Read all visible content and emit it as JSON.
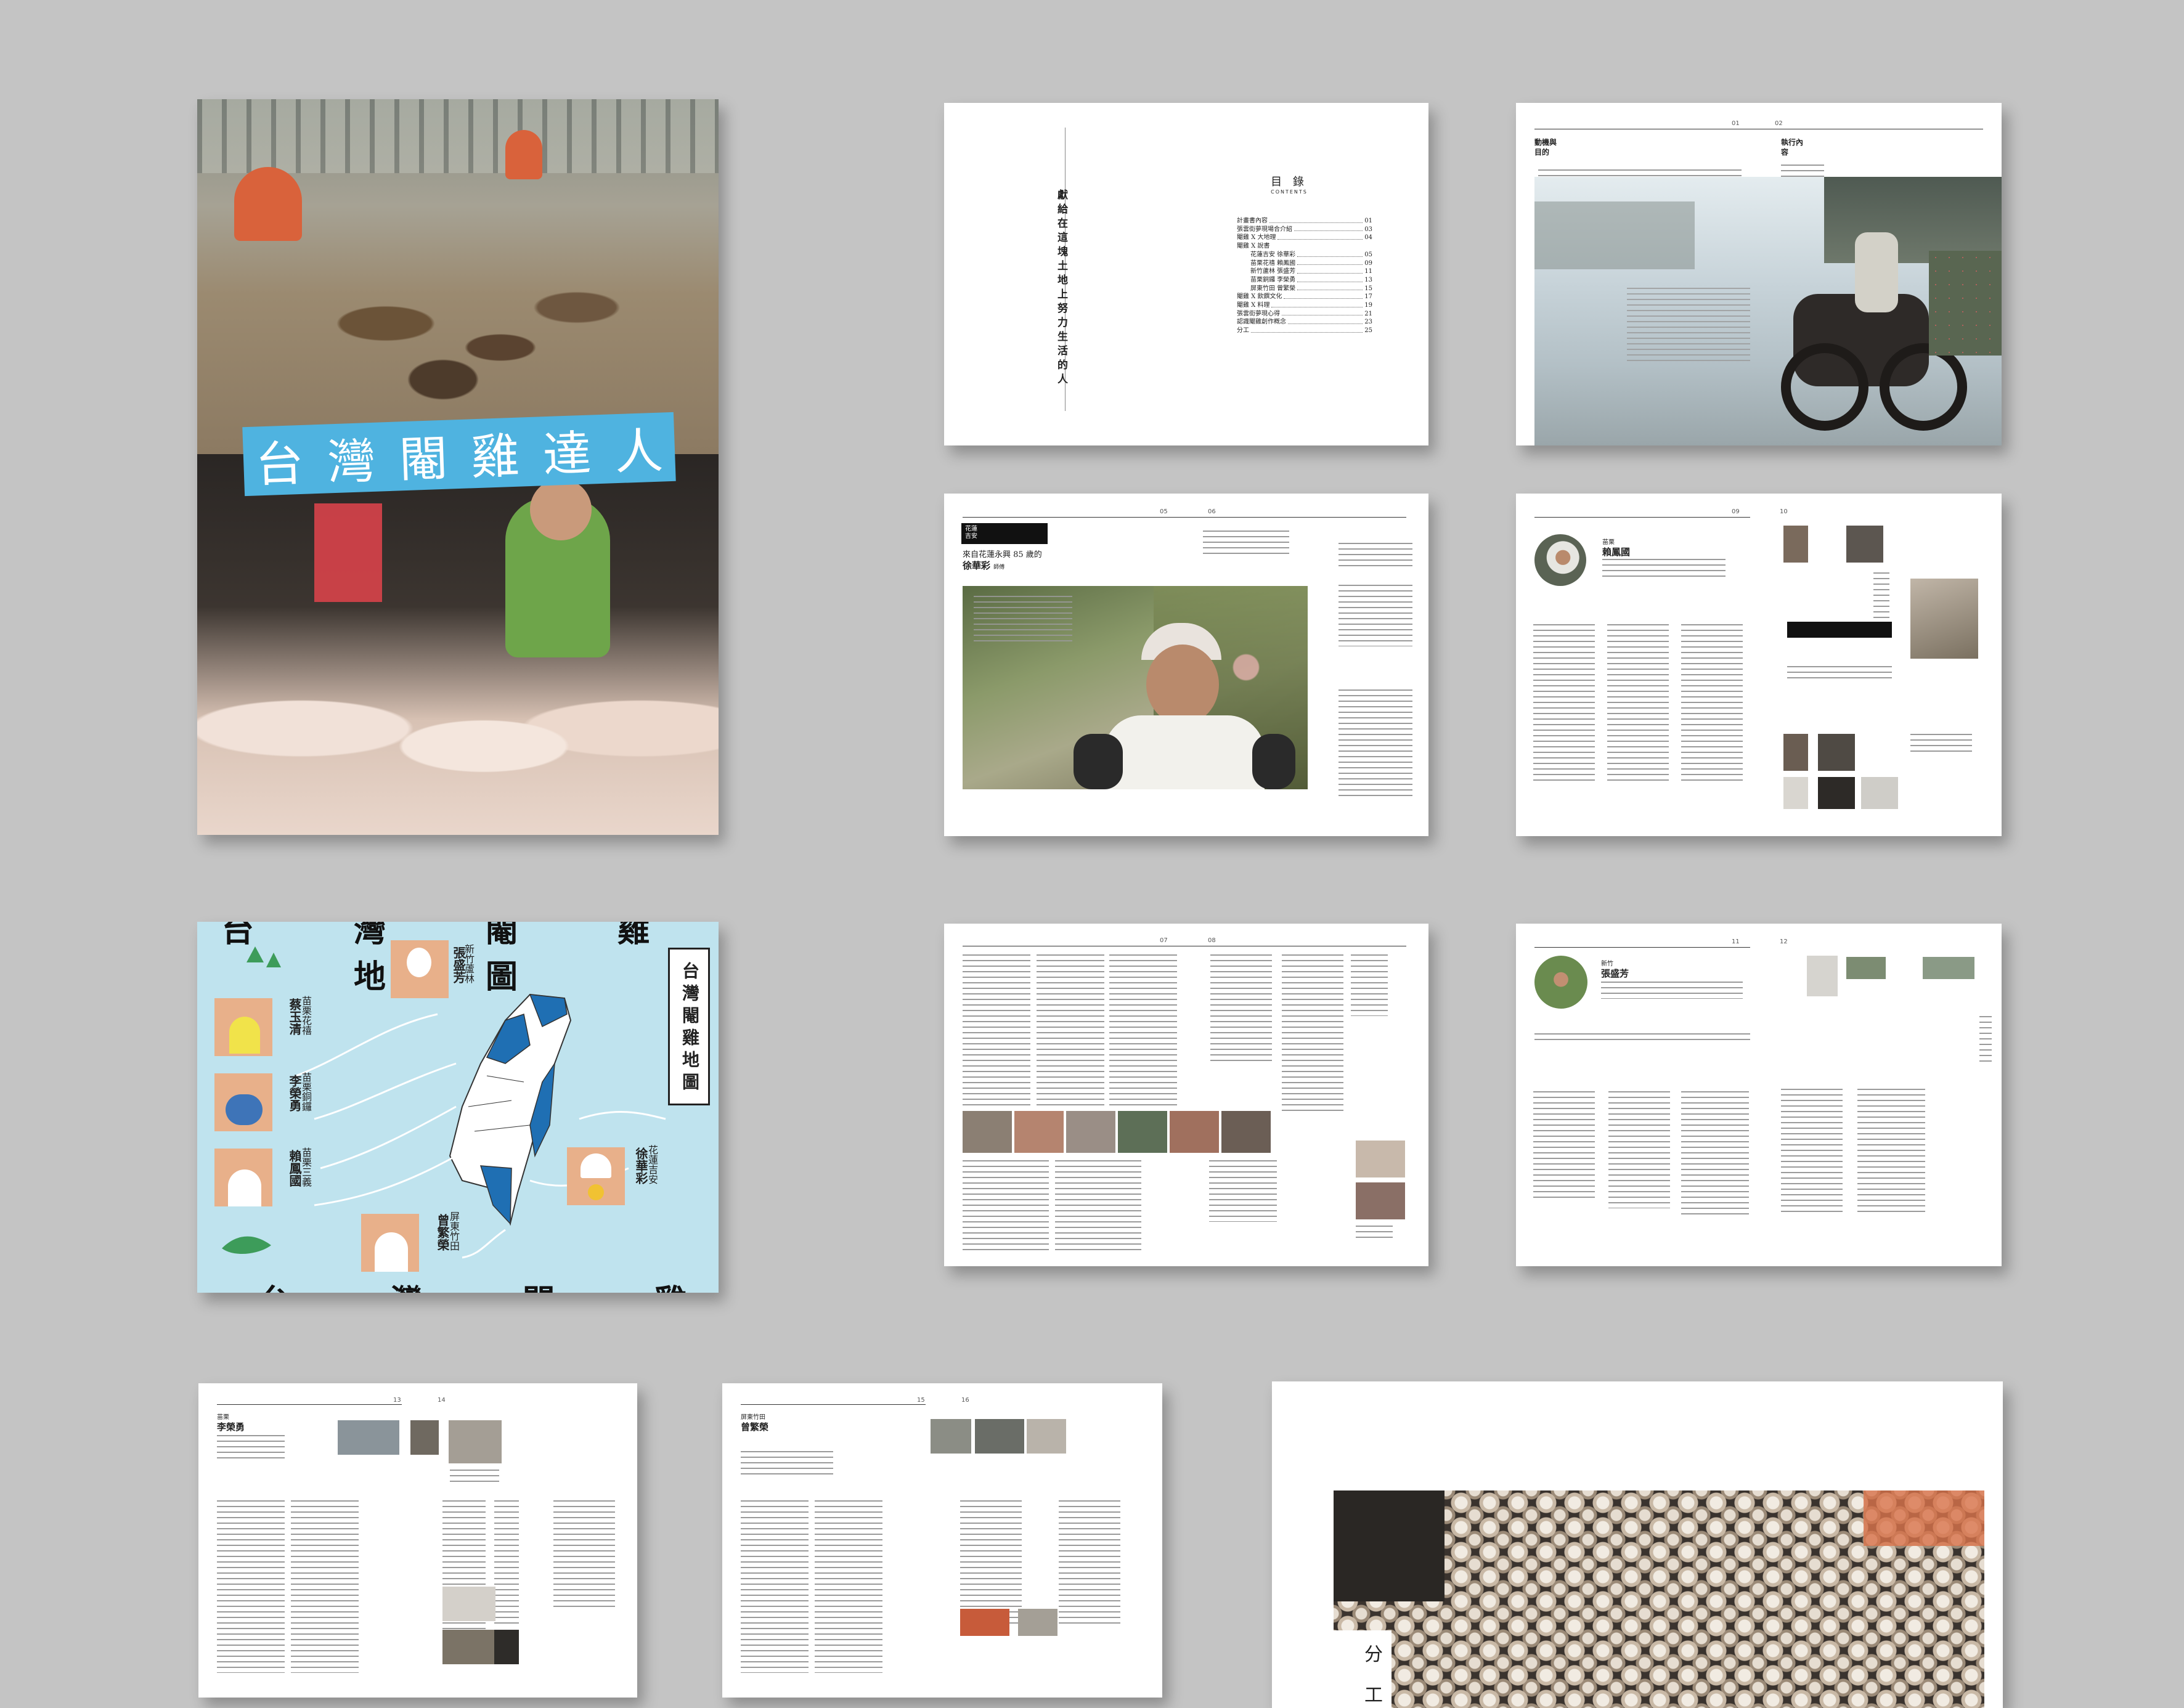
{
  "cover": {
    "title_chars": [
      "台",
      "灣",
      "閹",
      "雞",
      "達",
      "人"
    ]
  },
  "dedication": {
    "text": "獻給在這塊土地上努力生活的人"
  },
  "toc": {
    "title": "目 錄",
    "subtitle": "CONTENTS",
    "entries": [
      {
        "label": "計畫書內容",
        "page": "01"
      },
      {
        "label": "張雲街夢現場合介紹",
        "page": "03"
      },
      {
        "label": "閹雞 X 大地理",
        "page": "04"
      },
      {
        "label": "閹雞 X 說書",
        "page": ""
      },
      {
        "label": "花蓮吉安 徐華彩",
        "page": "05"
      },
      {
        "label": "苗栗花禧 賴鳳國",
        "page": "09"
      },
      {
        "label": "新竹蘆林 張盛芳",
        "page": "11"
      },
      {
        "label": "苗栗銅鑼 李榮勇",
        "page": "13"
      },
      {
        "label": "屏東竹田 曾繁榮",
        "page": "15"
      },
      {
        "label": "閹雞 X 飲饌文化",
        "page": "17"
      },
      {
        "label": "閹雞 X 料理",
        "page": "19"
      },
      {
        "label": "張雲街夢現心得",
        "page": "21"
      },
      {
        "label": "認識閹雞創作概念",
        "page": "23"
      },
      {
        "label": "分工",
        "page": "25"
      }
    ]
  },
  "spread_p01": {
    "page_left": "01",
    "page_right": "02",
    "left_heading": "動機與目的",
    "right_heading": "執行內容"
  },
  "spread_xu": {
    "kicker": "花蓮吉安",
    "subtitle": "來自花蓮永興 85 歲的",
    "name": "徐華彩",
    "suffix": "師傅",
    "page_left": "05",
    "page_right": "06"
  },
  "spread_lai": {
    "kicker": "苗栗",
    "name": "賴鳳國",
    "page_left": "09",
    "page_right": "10"
  },
  "map": {
    "top_title": "台 灣 閹 雞 地 圖",
    "bottom_title": "台 灣 閹 雞 地 圖",
    "side_title": "台灣閹雞地圖",
    "people": [
      {
        "place": "新竹蘆林",
        "name": "張盛芳"
      },
      {
        "place": "苗栗花禧",
        "name": "蔡玉清"
      },
      {
        "place": "苗栗銅鑼",
        "name": "李榮勇"
      },
      {
        "place": "苗栗三義",
        "name": "賴鳳國"
      },
      {
        "place": "花蓮吉安",
        "name": "徐華彩"
      },
      {
        "place": "屏東竹田",
        "name": "曾繁榮"
      }
    ]
  },
  "spread_article": {
    "page_left": "07",
    "page_right": "08"
  },
  "spread_zhang": {
    "kicker": "新竹",
    "name": "張盛芳",
    "page_left": "11",
    "page_right": "12"
  },
  "spread_li": {
    "kicker": "苗栗",
    "name": "李榮勇",
    "page_left": "13",
    "page_right": "14"
  },
  "spread_zeng": {
    "kicker": "屏東竹田",
    "name": "曾繁榮",
    "page_left": "15",
    "page_right": "16"
  },
  "division": {
    "chars": [
      "分",
      "工"
    ]
  },
  "colors": {
    "background": "#c4c4c4",
    "banner_blue": "#4fb3e0",
    "map_bg": "#bfe3ee",
    "map_blue": "#1f6fb3"
  }
}
